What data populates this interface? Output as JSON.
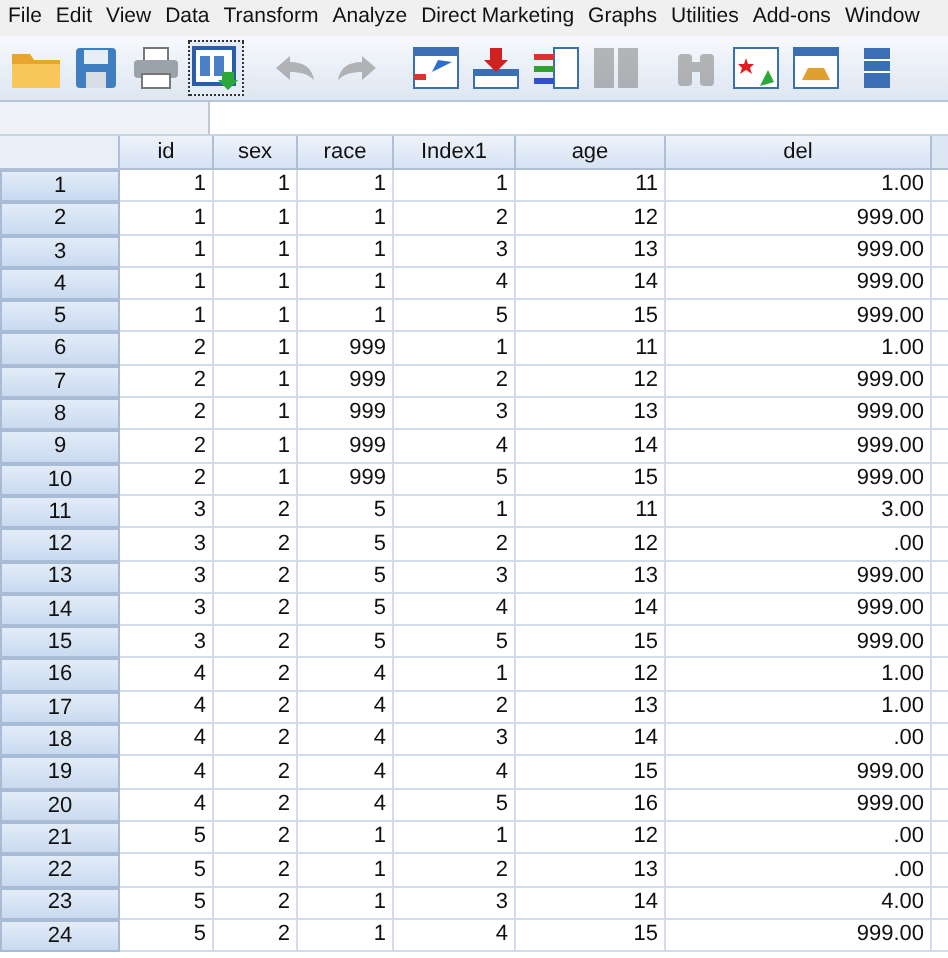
{
  "menu": [
    "File",
    "Edit",
    "View",
    "Data",
    "Transform",
    "Analyze",
    "Direct Marketing",
    "Graphs",
    "Utilities",
    "Add-ons",
    "Window"
  ],
  "toolbar": [
    {
      "kind": "open",
      "disabled": false,
      "selected": false
    },
    {
      "kind": "save",
      "disabled": false,
      "selected": false
    },
    {
      "kind": "print",
      "disabled": false,
      "selected": false
    },
    {
      "kind": "recall",
      "disabled": false,
      "selected": true
    },
    {
      "kind": "undo",
      "disabled": true,
      "selected": false
    },
    {
      "kind": "redo",
      "disabled": true,
      "selected": false
    },
    {
      "kind": "goto",
      "disabled": false,
      "selected": false
    },
    {
      "kind": "insert-case",
      "disabled": false,
      "selected": false
    },
    {
      "kind": "insert-variable",
      "disabled": false,
      "selected": false
    },
    {
      "kind": "split",
      "disabled": true,
      "selected": false
    },
    {
      "kind": "find",
      "disabled": true,
      "selected": false
    },
    {
      "kind": "select",
      "disabled": false,
      "selected": false
    },
    {
      "kind": "weight",
      "disabled": false,
      "selected": false
    },
    {
      "kind": "grid",
      "disabled": false,
      "selected": false
    }
  ],
  "table": {
    "columns": [
      "id",
      "sex",
      "race",
      "Index1",
      "age",
      "del"
    ],
    "rows": [
      {
        "n": "1",
        "cells": [
          "1",
          "1",
          "1",
          "1",
          "11",
          "1.00"
        ]
      },
      {
        "n": "2",
        "cells": [
          "1",
          "1",
          "1",
          "2",
          "12",
          "999.00"
        ]
      },
      {
        "n": "3",
        "cells": [
          "1",
          "1",
          "1",
          "3",
          "13",
          "999.00"
        ]
      },
      {
        "n": "4",
        "cells": [
          "1",
          "1",
          "1",
          "4",
          "14",
          "999.00"
        ]
      },
      {
        "n": "5",
        "cells": [
          "1",
          "1",
          "1",
          "5",
          "15",
          "999.00"
        ]
      },
      {
        "n": "6",
        "cells": [
          "2",
          "1",
          "999",
          "1",
          "11",
          "1.00"
        ]
      },
      {
        "n": "7",
        "cells": [
          "2",
          "1",
          "999",
          "2",
          "12",
          "999.00"
        ]
      },
      {
        "n": "8",
        "cells": [
          "2",
          "1",
          "999",
          "3",
          "13",
          "999.00"
        ]
      },
      {
        "n": "9",
        "cells": [
          "2",
          "1",
          "999",
          "4",
          "14",
          "999.00"
        ]
      },
      {
        "n": "10",
        "cells": [
          "2",
          "1",
          "999",
          "5",
          "15",
          "999.00"
        ]
      },
      {
        "n": "11",
        "cells": [
          "3",
          "2",
          "5",
          "1",
          "11",
          "3.00"
        ]
      },
      {
        "n": "12",
        "cells": [
          "3",
          "2",
          "5",
          "2",
          "12",
          ".00"
        ]
      },
      {
        "n": "13",
        "cells": [
          "3",
          "2",
          "5",
          "3",
          "13",
          "999.00"
        ]
      },
      {
        "n": "14",
        "cells": [
          "3",
          "2",
          "5",
          "4",
          "14",
          "999.00"
        ]
      },
      {
        "n": "15",
        "cells": [
          "3",
          "2",
          "5",
          "5",
          "15",
          "999.00"
        ]
      },
      {
        "n": "16",
        "cells": [
          "4",
          "2",
          "4",
          "1",
          "12",
          "1.00"
        ]
      },
      {
        "n": "17",
        "cells": [
          "4",
          "2",
          "4",
          "2",
          "13",
          "1.00"
        ]
      },
      {
        "n": "18",
        "cells": [
          "4",
          "2",
          "4",
          "3",
          "14",
          ".00"
        ]
      },
      {
        "n": "19",
        "cells": [
          "4",
          "2",
          "4",
          "4",
          "15",
          "999.00"
        ]
      },
      {
        "n": "20",
        "cells": [
          "4",
          "2",
          "4",
          "5",
          "16",
          "999.00"
        ]
      },
      {
        "n": "21",
        "cells": [
          "5",
          "2",
          "1",
          "1",
          "12",
          ".00"
        ]
      },
      {
        "n": "22",
        "cells": [
          "5",
          "2",
          "1",
          "2",
          "13",
          ".00"
        ]
      },
      {
        "n": "23",
        "cells": [
          "5",
          "2",
          "1",
          "3",
          "14",
          "4.00"
        ]
      },
      {
        "n": "24",
        "cells": [
          "5",
          "2",
          "1",
          "4",
          "15",
          "999.00"
        ]
      }
    ]
  }
}
